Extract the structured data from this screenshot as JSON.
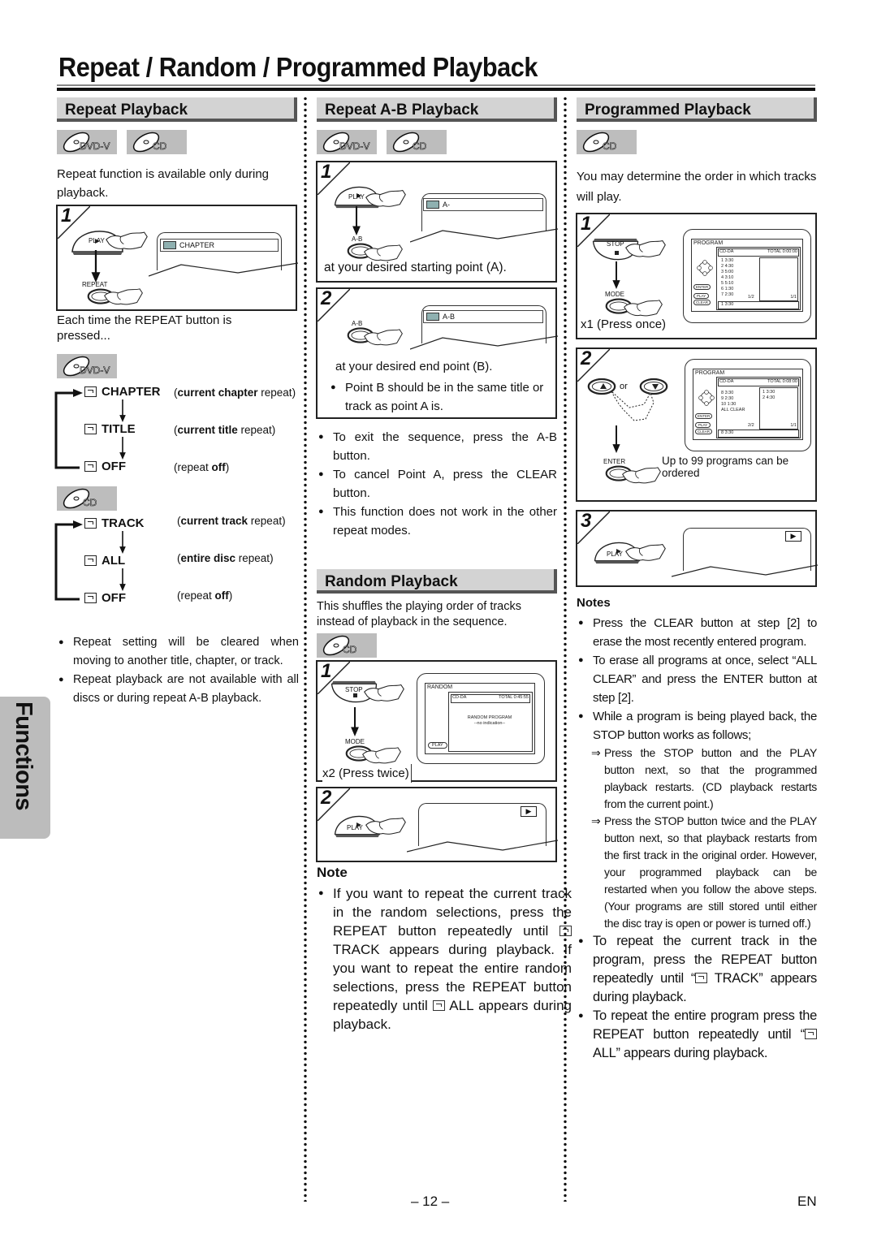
{
  "page": {
    "title": "Repeat / Random / Programmed Playback",
    "side_tab": "Functions",
    "page_number": "– 12 –",
    "language": "EN"
  },
  "badges": {
    "dvd": "DVD-V",
    "cd": "CD"
  },
  "icons": {
    "repeat": "repeat-icon",
    "play": "play-triangle-icon",
    "hand": "pressing-hand-icon",
    "arrow": "down-arrow-icon"
  },
  "repeat": {
    "heading": "Repeat Playback",
    "intro": "Repeat function is available only during playback.",
    "step1": {
      "num": "1",
      "play_label": "PLAY",
      "repeat_label": "REPEAT",
      "osd": "CHAPTER"
    },
    "each_time": "Each time the REPEAT button is pressed...",
    "dvd_sequence": [
      {
        "label": "CHAPTER",
        "desc_bold": "current chapter",
        "desc_rest": " repeat",
        "desc_pre": "(",
        "desc_post": ")"
      },
      {
        "label": "TITLE",
        "desc_bold": "current title",
        "desc_rest": " repeat",
        "desc_pre": "(",
        "desc_post": ")"
      },
      {
        "label": "OFF",
        "desc_pre": "(repeat ",
        "desc_bold": "off",
        "desc_rest": "",
        "desc_post": ")"
      }
    ],
    "cd_sequence": [
      {
        "label": "TRACK",
        "desc_bold": "current track",
        "desc_rest": " repeat",
        "desc_pre": "(",
        "desc_post": ")"
      },
      {
        "label": "ALL",
        "desc_bold": "entire disc",
        "desc_rest": " repeat",
        "desc_pre": "(",
        "desc_post": ")"
      },
      {
        "label": "OFF",
        "desc_pre": "(repeat ",
        "desc_bold": "off",
        "desc_rest": "",
        "desc_post": ")"
      }
    ],
    "notes": [
      "Repeat setting will be cleared when moving to another title, chapter, or track.",
      "Repeat playback are not available with all discs or during repeat A-B playback."
    ]
  },
  "repeat_ab": {
    "heading": "Repeat A-B Playback",
    "step1": {
      "num": "1",
      "play_label": "PLAY",
      "ab_label": "A-B",
      "osd": "A-",
      "caption": "at your desired starting point (A)."
    },
    "step2": {
      "num": "2",
      "ab_label": "A-B",
      "osd": "A-B",
      "caption": "at your desired end point (B).",
      "note": "Point B should be in the same title or track as point A is."
    },
    "notes": [
      "To exit the sequence, press the A-B button.",
      "To cancel Point A, press the CLEAR button.",
      "This function does not work in the other repeat modes."
    ]
  },
  "random": {
    "heading": "Random Playback",
    "intro": "This shuffles the playing order of tracks instead of playback in the sequence.",
    "step1": {
      "num": "1",
      "stop_label": "STOP",
      "mode_label": "MODE",
      "caption": "x2 (Press twice)",
      "osd": {
        "title": "RANDOM",
        "disc": "CD-DA",
        "total": "TOTAL 0:45:55",
        "line1": "RANDOM PROGRAM",
        "line2": "--no indication--",
        "play_btn": "PLAY"
      }
    },
    "step2": {
      "num": "2",
      "play_label": "PLAY"
    },
    "note_heading": "Note",
    "note_parts": {
      "a": "If you want to repeat the current track in the random selections, press the REPEAT button repeatedly until ",
      "b": " TRACK appears during playback. If you want to repeat the entire random selections, press the  REPEAT button repeatedly until ",
      "c": " ALL appears during playback."
    }
  },
  "programmed": {
    "heading": "Programmed Playback",
    "intro": "You may determine the order in which tracks will play.",
    "step1": {
      "num": "1",
      "stop_label": "STOP",
      "mode_label": "MODE",
      "caption": "x1 (Press once)",
      "osd": {
        "title": "PROGRAM",
        "disc": "CD-DA",
        "total": "TOTAL 0:00:00",
        "tracks": [
          "1  3:30",
          "2  4:30",
          "3  5:00",
          "4  3:10",
          "5  5:10",
          "6  1:30",
          "7  2:30"
        ],
        "page_left": "1/2",
        "page_right": "1/1",
        "current": "1  3:30",
        "buttons": [
          "ENTER",
          "PLAY",
          "CLEAR"
        ]
      }
    },
    "step2": {
      "num": "2",
      "or_label": "or",
      "enter_label": "ENTER",
      "caption": "Up to 99 programs can be ordered",
      "osd": {
        "title": "PROGRAM",
        "disc": "CD-DA",
        "total": "TOTAL 0:08:00",
        "tracks": [
          "8  3:30",
          "9  2:30",
          "10 1:30",
          "ALL CLEAR"
        ],
        "programmed": [
          "1  3:30",
          "2  4:30"
        ],
        "page_left": "2/2",
        "page_right": "1/1",
        "current": "8  3:30",
        "buttons": [
          "ENTER",
          "PLAY",
          "CLEAR"
        ]
      }
    },
    "step3": {
      "num": "3",
      "play_label": "PLAY"
    },
    "notes_heading": "Notes",
    "notes": [
      "Press the CLEAR button at step [2] to erase the most recently entered program.",
      "To erase all programs at once, select “ALL CLEAR” and press the ENTER button at step [2].",
      "While a program is being played back, the STOP button works as follows;"
    ],
    "sub_notes": [
      "Press the STOP button and the PLAY button next, so that the programmed playback restarts. (CD playback restarts from the current point.)",
      "Press the STOP button twice and the PLAY button next, so that playback restarts from the first track in the original order. However, your programmed playback can be restarted when you follow the above steps. (Your programs are still stored until either the disc tray is open or power is turned off.)"
    ],
    "arrow_glyph": "⇒",
    "extra_parts": {
      "t1a": "To repeat the current track in the program, press the REPEAT button repeatedly until “",
      "t1b": " TRACK” appears during playback.",
      "t2a": "To repeat the entire program press the REPEAT button repeatedly until “",
      "t2b": " ALL” appears during playback."
    }
  }
}
